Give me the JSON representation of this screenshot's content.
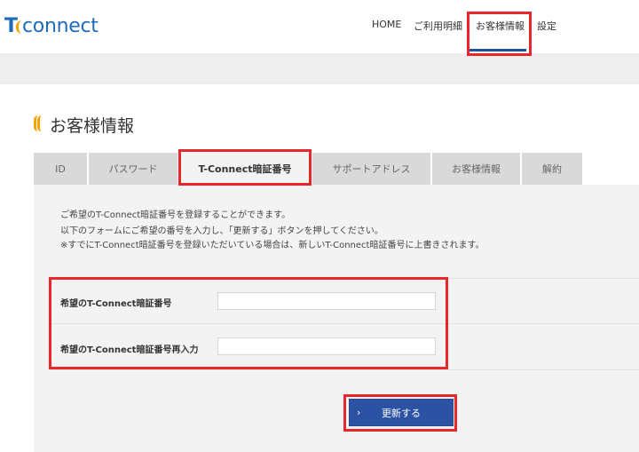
{
  "logo": {
    "t": "T",
    "rest": "connect"
  },
  "nav": {
    "home": "HOME",
    "usage": "ご利用明細",
    "customer": "お客様情報",
    "settings": "設定"
  },
  "page": {
    "title": "お客様情報"
  },
  "tabs": [
    {
      "label": "ID"
    },
    {
      "label": "パスワード"
    },
    {
      "label": "T-Connect暗証番号"
    },
    {
      "label": "サポートアドレス"
    },
    {
      "label": "お客様情報"
    },
    {
      "label": "解約"
    }
  ],
  "description": [
    "ご希望のT-Connect暗証番号を登録することができます。",
    "以下のフォームにご希望の番号を入力し、「更新する」ボタンを押してください。",
    "※すでにT-Connect暗証番号を登録いただいている場合は、新しいT-Connect暗証番号に上書きされます。"
  ],
  "form": {
    "pin_label": "希望のT-Connect暗証番号",
    "pin_value": "",
    "pin_confirm_label": "希望のT-Connect暗証番号再入力",
    "pin_confirm_value": ""
  },
  "submit": {
    "label": "更新する",
    "chevron": "›"
  },
  "colors": {
    "accent": "#f5a200",
    "brand": "#1e6bb8",
    "button": "#2c53a3",
    "highlight": "#e8262b"
  }
}
